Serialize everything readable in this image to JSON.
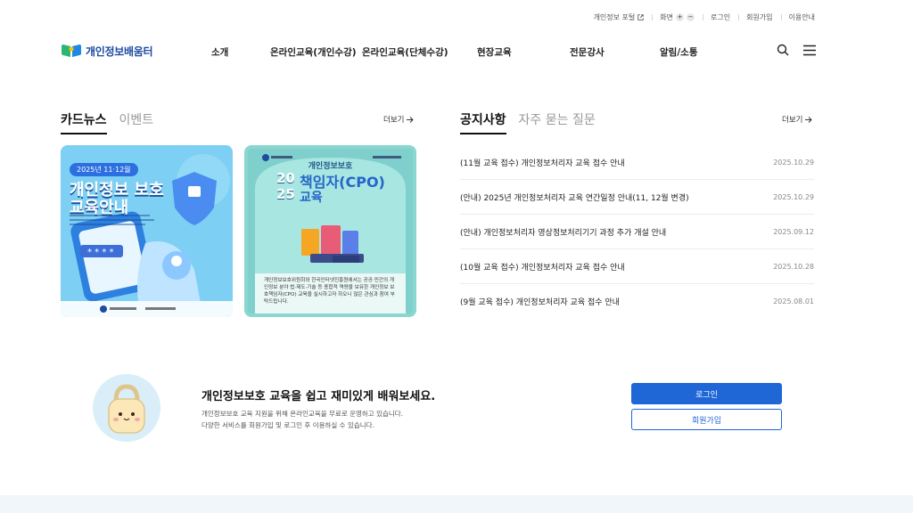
{
  "utility": {
    "portal": "개인정보 포털",
    "screen": "화면",
    "zoom_in": "+",
    "zoom_out": "−",
    "login": "로그인",
    "signup": "회원가입",
    "guide": "이용안내"
  },
  "header": {
    "logo": "개인정보배움터",
    "nav": [
      "소개",
      "온라인교육(개인수강)",
      "온라인교육(단체수강)",
      "현장교육",
      "전문강사",
      "알림/소통"
    ]
  },
  "cards_section": {
    "tab_active": "카드뉴스",
    "tab_inactive": "이벤트",
    "more": "더보기",
    "card1": {
      "badge": "2025년 11·12월",
      "title1": "개인정보 보호",
      "title2": "교육안내"
    },
    "card2": {
      "subtitle": "개인정보보호",
      "title_prefix": "책임자(CPO)",
      "title_suffix": "교육",
      "year_top": "20",
      "year_bottom": "25",
      "desc": "개인정보보호위원회와 한국인터넷진흥원에서는 공공·민간의 개인정보 분야 법·제도·기술 등 종합적 역량을 보유한 개인정보 보호책임자(CPO) 교육을 실시하고자 하오니 많은 관심과 참여 부탁드립니다."
    }
  },
  "notice_section": {
    "tab_active": "공지사항",
    "tab_inactive": "자주 묻는 질문",
    "more": "더보기",
    "items": [
      {
        "title": "(11월 교육 접수) 개인정보처리자 교육 접수 안내",
        "date": "2025.10.29"
      },
      {
        "title": "(안내) 2025년 개인정보처리자 교육 연간일정 안내(11, 12월 변경)",
        "date": "2025.10.29"
      },
      {
        "title": "(안내) 개인정보처리자 영상정보처리기기 과정 추가 개설 안내",
        "date": "2025.09.12"
      },
      {
        "title": "(10월 교육 접수) 개인정보처리자 교육 접수 안내",
        "date": "2025.10.28"
      },
      {
        "title": "(9월 교육 접수) 개인정보처리자 교육 접수 안내",
        "date": "2025.08.01"
      }
    ]
  },
  "promo": {
    "title": "개인정보보호 교육을 쉽고 재미있게 배워보세요.",
    "desc1": "개인정보보호 교육 지원을 위해 온라인교육을 무료로 운영하고 있습니다.",
    "desc2": "다양한 서비스를 회원가입 및 로그인 후 이용하실 수 있습니다.",
    "login_button": "로그인",
    "signup_button": "회원가입"
  },
  "colors": {
    "accent": "#1f66d6",
    "logo": "#1e4aa0",
    "card1_bg": "#66c4ee",
    "card2_bg": "#7fd0cc"
  }
}
